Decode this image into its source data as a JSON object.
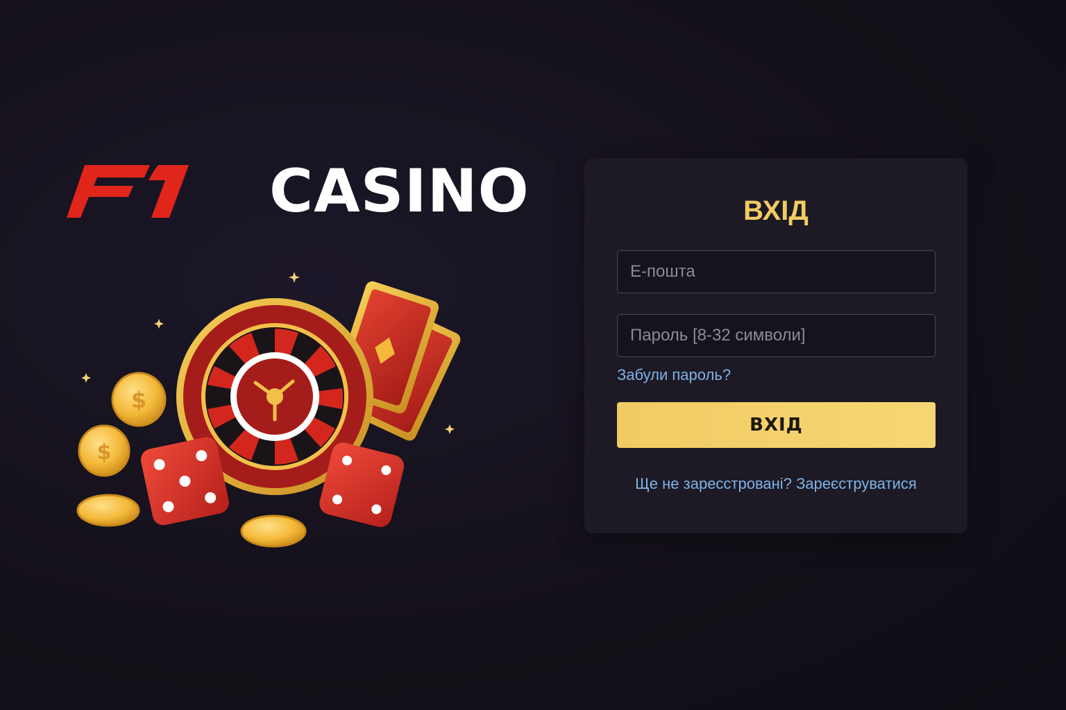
{
  "brand": {
    "mark_text": "F1",
    "word": "CASINO",
    "mark_color": "#e0251b",
    "word_color": "#ffffff"
  },
  "illustration": {
    "icons": [
      "roulette-wheel-icon",
      "playing-cards-icon",
      "dice-icon",
      "coin-icon",
      "sparkle-icon"
    ]
  },
  "login": {
    "title": "ВХІД",
    "email_placeholder": "Е-пошта",
    "password_placeholder": "Пароль [8-32 символи]",
    "forgot_label": "Забули пароль?",
    "submit_label": "ВХІД",
    "register_prompt": "Ще не заресстровані?",
    "register_link": "Зареєструватися"
  },
  "colors": {
    "background": "#15111f",
    "card": "#1d1a25",
    "accent_gold": "#f2cb63",
    "link_blue": "#7fb2e6"
  }
}
